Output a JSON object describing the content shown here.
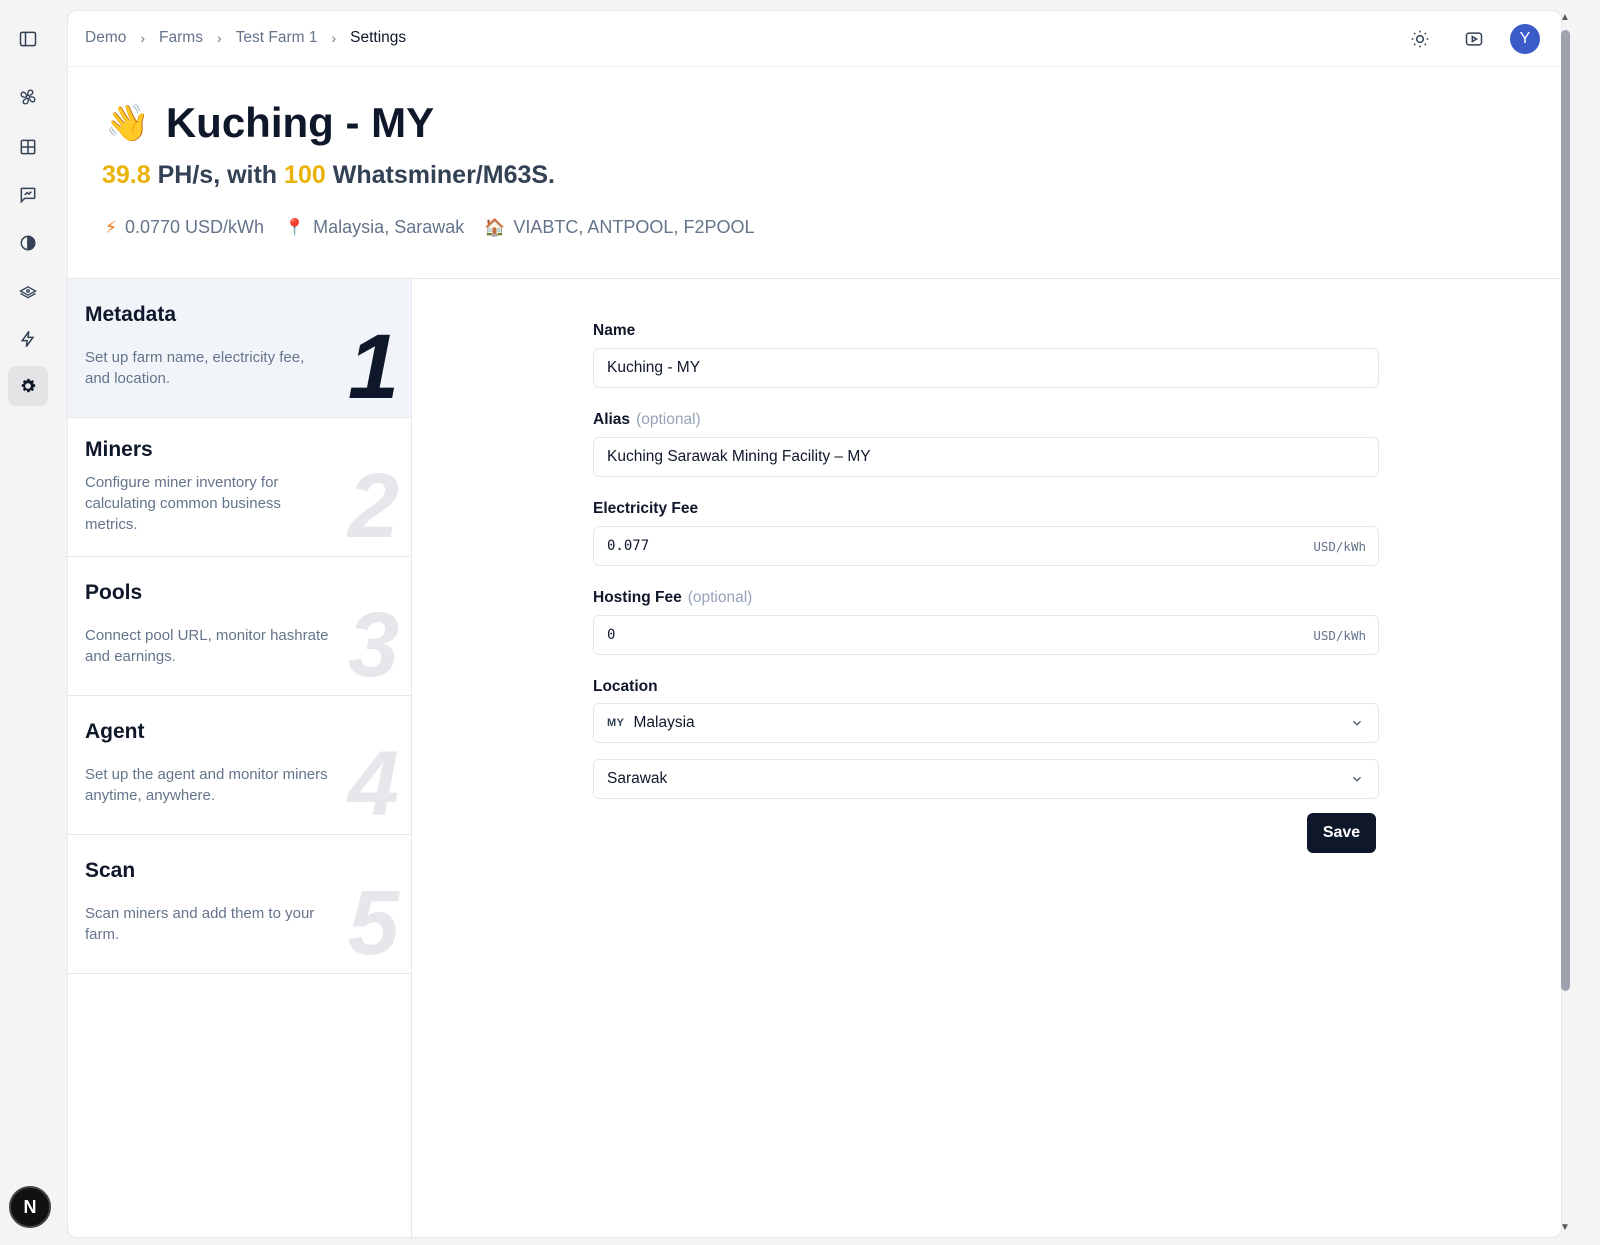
{
  "breadcrumb": [
    "Demo",
    "Farms",
    "Test Farm 1",
    "Settings"
  ],
  "header": {
    "emoji": "👋",
    "title": "Kuching - MY",
    "hashrate": "39.8",
    "hashrate_unit": "PH/s, with",
    "miner_count": "100",
    "miner_model": "Whatsminer/M63S.",
    "electricity": "0.0770 USD/kWh",
    "location": "Malaysia, Sarawak",
    "pools": "VIABTC, ANTPOOL, F2POOL"
  },
  "avatar_initial": "Y",
  "rail_badge": "N",
  "steps": [
    {
      "title": "Metadata",
      "desc": "Set up farm name, electricity fee, and location.",
      "num": "1"
    },
    {
      "title": "Miners",
      "desc": "Configure miner inventory for calculating common business metrics.",
      "num": "2"
    },
    {
      "title": "Pools",
      "desc": "Connect pool URL, monitor hashrate and earnings.",
      "num": "3"
    },
    {
      "title": "Agent",
      "desc": "Set up the agent and monitor miners anytime, anywhere.",
      "num": "4"
    },
    {
      "title": "Scan",
      "desc": "Scan miners and add them to your farm.",
      "num": "5"
    }
  ],
  "form": {
    "name_label": "Name",
    "name_value": "Kuching - MY",
    "alias_label": "Alias",
    "optional": "(optional)",
    "alias_value": "Kuching Sarawak Mining Facility – MY",
    "electricity_label": "Electricity Fee",
    "electricity_value": "0.077",
    "unit": "USD/kWh",
    "hosting_label": "Hosting Fee",
    "hosting_value": "0",
    "location_label": "Location",
    "country_code": "MY",
    "country": "Malaysia",
    "region": "Sarawak",
    "save_label": "Save"
  },
  "colors": {
    "accent": "#eab308",
    "primary": "#0f172a",
    "avatar": "#3b5bc9"
  }
}
